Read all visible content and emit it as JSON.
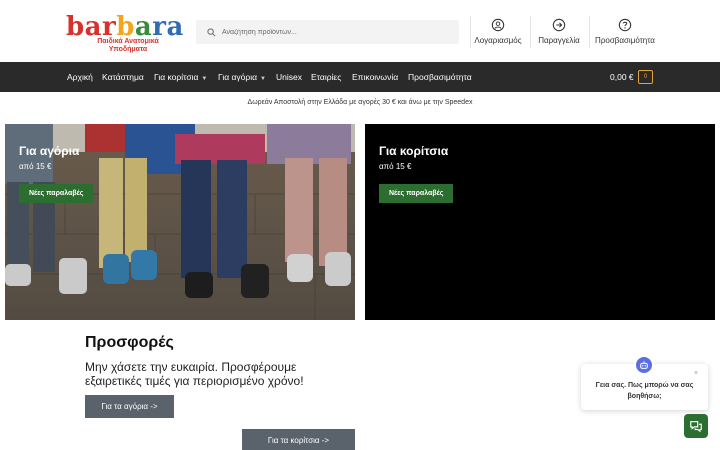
{
  "header": {
    "logo": {
      "word_parts": [
        "bar",
        "b",
        "a",
        "ra"
      ],
      "tagline": "Παιδικά Ανατομικά Υποδήματα"
    },
    "search": {
      "placeholder": "Αναζήτηση προϊόντων..."
    },
    "links": {
      "account": "Λογαριασμός",
      "orders": "Παραγγελία",
      "accessibility": "Προσβασιμότητα"
    }
  },
  "nav": {
    "items": [
      "Αρχική",
      "Κατάστημα",
      "Για κορίτσια",
      "Για αγόρια",
      "Unisex",
      "Εταιρίες",
      "Επικοινωνία",
      "Προσβασιμότητα"
    ],
    "cart_total": "0,00 €",
    "cart_count": "0"
  },
  "shipping_notice": "Δωρεάν Αποστολή στην Ελλάδα με αγορές 30 € και άνω με την Speedex",
  "hero": {
    "boys": {
      "title": "Για αγόρια",
      "price": "από 15 €",
      "button": "Νέες παραλαβές"
    },
    "girls": {
      "title": "Για κορίτσια",
      "price": "από 15 €",
      "button": "Νέες παραλαβές"
    }
  },
  "offers": {
    "title": "Προσφορές",
    "text": "Μην χάσετε την ευκαιρία. Προσφέρουμε εξαιρετικές τιμές για περιορισμένο χρόνο!",
    "btn_boys": "Για τα αγόρια ->",
    "btn_girls": "Για τα κορίτσια ->"
  },
  "chat": {
    "message": "Γεια σας. Πως μπορώ να σας βοηθήσω;",
    "close": "×"
  },
  "colors": {
    "nav_bg": "#2a2a2a",
    "accent_green": "#2c6e2f",
    "cart_badge": "#e3a33a",
    "chat_avatar": "#5b6fe0"
  }
}
